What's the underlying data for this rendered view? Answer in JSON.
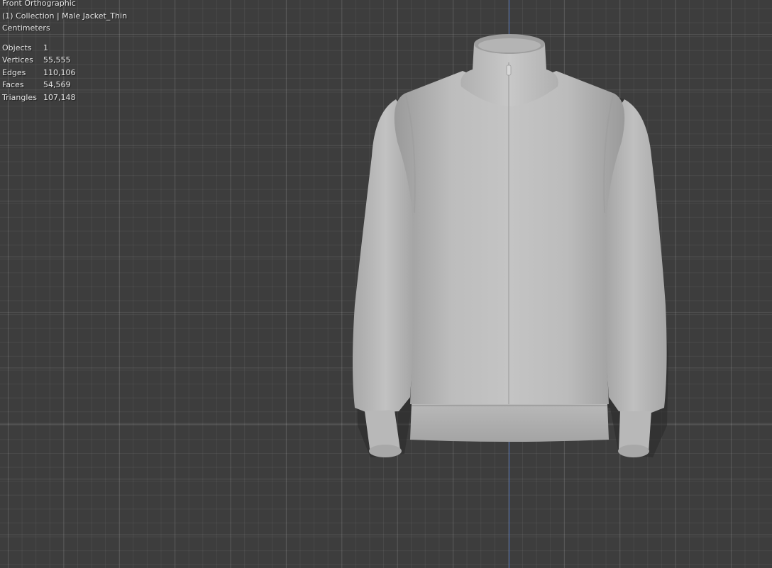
{
  "viewport": {
    "view_name": "Front Orthographic",
    "collection_line": "(1) Collection | Male Jacket_Thin",
    "units": "Centimeters",
    "axis_color": "#4f6fb0",
    "background_color": "#3d3d3d"
  },
  "stats": [
    {
      "label": "Objects",
      "value": "1"
    },
    {
      "label": "Vertices",
      "value": "55,555"
    },
    {
      "label": "Edges",
      "value": "110,106"
    },
    {
      "label": "Faces",
      "value": "54,569"
    },
    {
      "label": "Triangles",
      "value": "107,148"
    }
  ],
  "model": {
    "object_name": "Male Jacket_Thin",
    "shading": "solid-gray"
  }
}
